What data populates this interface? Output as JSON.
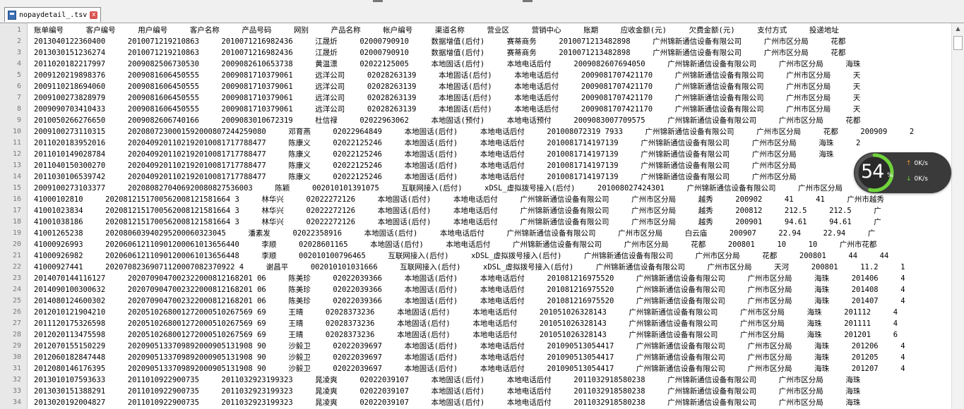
{
  "tab": {
    "name": "nopaydetail_.tsv",
    "close_label": "x"
  },
  "lines": [
    "账单编号     客户编号     用户编号     客户名称     产品号码     网别     产品名称     帐户编号     渠道名称     营业区     营销中心     账期     应收金额(元)     欠费金额(元)     支付方式     投递地址",
    "2013040122360400     2010071219210863     2010071216982436     江晟炘     02000790910     数据增值(后付)     赛蒂商务     2010071213482898     广州锦新通信设备有限公司     广州市区分局     花都",
    "2013030151236274     2010071219210863     2010071216982436     江晟炘     02000790910     数据增值(后付)     赛蒂商务     2010071213482898     广州锦新通信设备有限公司     广州市区分局     花都",
    "2011020182217997     2009082506730530     2009082610653738     黄温漂     02022125005     本地固话(后付)     本地电话后付     2009082607694050     广州锦新通信设备有限公司     广州市区分局     海珠",
    "2009120219898376     2009081606450555     2009081710379061     远洋公司     02028263139     本地固话(后付)     本地电话后付     2009081707421170     广州锦新通信设备有限公司     广州市区分局     天",
    "2009110218694060     2009081606450555     2009081710379061     远洋公司     02028263139     本地固话(后付)     本地电话后付     2009081707421170     广州锦新通信设备有限公司     广州市区分局     天",
    "2009100273828979     2009081606450555     2009081710379061     远洋公司     02028263139     本地固话(后付)     本地电话后付     2009081707421170     广州锦新通信设备有限公司     广州市区分局     天",
    "2009090703410433     2009081606450555     2009081710379061     远洋公司     02028263139     本地固话(后付)     本地电话后付     2009081707421170     广州锦新通信设备有限公司     广州市区分局     天",
    "2010050266276650     2009082606740166     2009083010672319     杜信禄     02022963062     本地固话(预付)     本地电话预付     2009083007709575     广州锦新通信设备有限公司     广州市区分局     花都",
    "2009100273110315     2020807230001592000807244259080     邓育燕     02022964849     本地固话(后付)     本地电话后付     201008072319 7933     广州锦新通信设备有限公司     广州市区分局     花都     200909     2",
    "2011020183952016     2020409201102192010081717788477     陈康义     02022125246     本地固话(后付)     本地电话后付     2010081714197139     广州锦新通信设备有限公司     广州市区分局     海珠     2",
    "2011010149028784     2020409201102192010081717788477     陈康义     02022125246     本地固话(后付)     本地电话后付     2010081714197139     广州锦新通信设备有限公司     广州市区分局     海珠",
    "2011040150300270     2020409201102192010081717788477     陈康义     02022125246     本地固话(后付)     本地电话后付     2010081714197139     广州锦新通信设备有限公司     广州市区分局",
    "2011030106539742     2020409201102192010081717788477     陈康义     02022125246     本地固话(后付)     本地电话后付     2010081714197139     广州锦新通信设备有限公司     广州市区分局",
    "2009100273103377     2020808270406920080827536003     陈颖     002010101391075     互联网接入(后付)     xDSL_虚拟拨号接入(后付)     201008027424301     广州锦新通信设备有限公司     广州市区分局",
    "41000102810     2020812151700562008121581664 3     林华兴     02022272126     本地固话(后付)     本地电话后付     广州锦新通信设备有限公司     广州市区分局     越秀     200902     41     41     广州市越秀",
    "41001023834     2020812151700562008121581664 3     林华兴     02022272126     本地固话(后付)     本地电话后付     广州锦新通信设备有限公司     广州市区分局     越秀     200812     212.5     212.5     广",
    "41001038186     2020812151700562008121581664 3     林华兴     02022272126     本地固话(后付)     本地电话后付     广州锦新通信设备有限公司     广州市区分局     越秀     200901     94.61     94.61     广",
    "41001265238     202080603940295200060323045     潘素发     02022358916     本地固话(后付)     本地电话后付     广州锦新通信设备有限公司     广州市区分局     白云庙     200907     22.94     22.94     广",
    "41000926993     202060612110901200061013656440     李顺     02028601165     本地固话(后付)     本地电话后付     广州锦新通信设备有限公司     广州市区分局     花都     200801     10     10     广州市花都",
    "41000926982     202060612110901200061013656448     李顺     002010100796465     互联网接入(后付)     xDSL_虚拟拨号接入(后付)     广州锦新通信设备有限公司     广州市区分局     花都     200801     44     44",
    "41000927441     20207082369071120007082370922 4     谢昌平     002010101031666     互联网接入(后付)     xDSL_虚拟拨号接入(后付)     广州锦新通信设备有限公司     广州市区分局     天河     200801     11.2     1",
    "2014070144116127     2020709047002322000812168201 06     陈美珍     02022039366     本地固话(后付)     本地电话后付     201081216975520     广州锦新通信设备有限公司     广州市区分局     海珠     201406     4",
    "2014090100300632     2020709047002322000812168201 06     陈美珍     02022039366     本地固话(后付)     本地电话后付     201081216975520     广州锦新通信设备有限公司     广州市区分局     海珠     201408     4",
    "2014080124600302     2020709047002322000812168201 06     陈美珍     02022039366     本地固话(后付)     本地电话后付     201081216975520     广州锦新通信设备有限公司     广州市区分局     海珠     201407     4",
    "2012010121904210     2020510268001272000510267569 69     王晴     02028373236     本地固话(后付)     本地电话后付     201051026328143     广州锦新通信设备有限公司     广州市区分局     海珠     201112     4",
    "2011120175326598     2020510268001272000510267569 69     王晴     02028373236     本地固话(后付)     本地电话后付     201051026328143     广州锦新通信设备有限公司     广州市区分局     海珠     201111     4",
    "2012020113475598     2020510268001272000510267569 69     王晴     02028373236     本地固话(后付)     本地电话后付     201051026328143     广州锦新通信设备有限公司     广州市区分局     海珠     201201     6",
    "2012070155150229     2020905133709892000905131908 90     沙毅卫     02022039697     本地固话(后付)     本地电话后付     201090513054417     广州锦新通信设备有限公司     广州市区分局     海珠     201206     4",
    "2012060182847448     2020905133709892000905131908 90     沙毅卫     02022039697     本地固话(后付)     本地电话后付     201090513054417     广州锦新通信设备有限公司     广州市区分局     海珠     201205     4",
    "2012080146176395     2020905133709892000905131908 90     沙毅卫     02022039697     本地固话(后付)     本地电话后付     201090513054417     广州锦新通信设备有限公司     广州市区分局     海珠     201207     4",
    "2013010107593633     2011010922900735     2011032923199323     晁凌爽     02022039107     本地固话(后付)     本地电话后付     2011032918580238     广州锦新通信设备有限公司     广州市区分局     海珠",
    "2013030151388291     2011010922900735     2011032923199323     晁凌爽     02022039107     本地固话(后付)     本地电话后付     2011032918580238     广州锦新通信设备有限公司     广州市区分局     海珠",
    "2013020192004827     2011010922900735     2011032923199323     晁凌爽     02022039107     本地固话(后付)     本地电话后付     2011032918580238     广州锦新通信设备有限公司     广州市区分局     海珠"
  ],
  "widget": {
    "percent": "54",
    "percent_sign": "%",
    "percent_value": 54,
    "upload_speed": "0K/s",
    "download_speed": "0K/s",
    "ring_color": "#6fd33b"
  }
}
